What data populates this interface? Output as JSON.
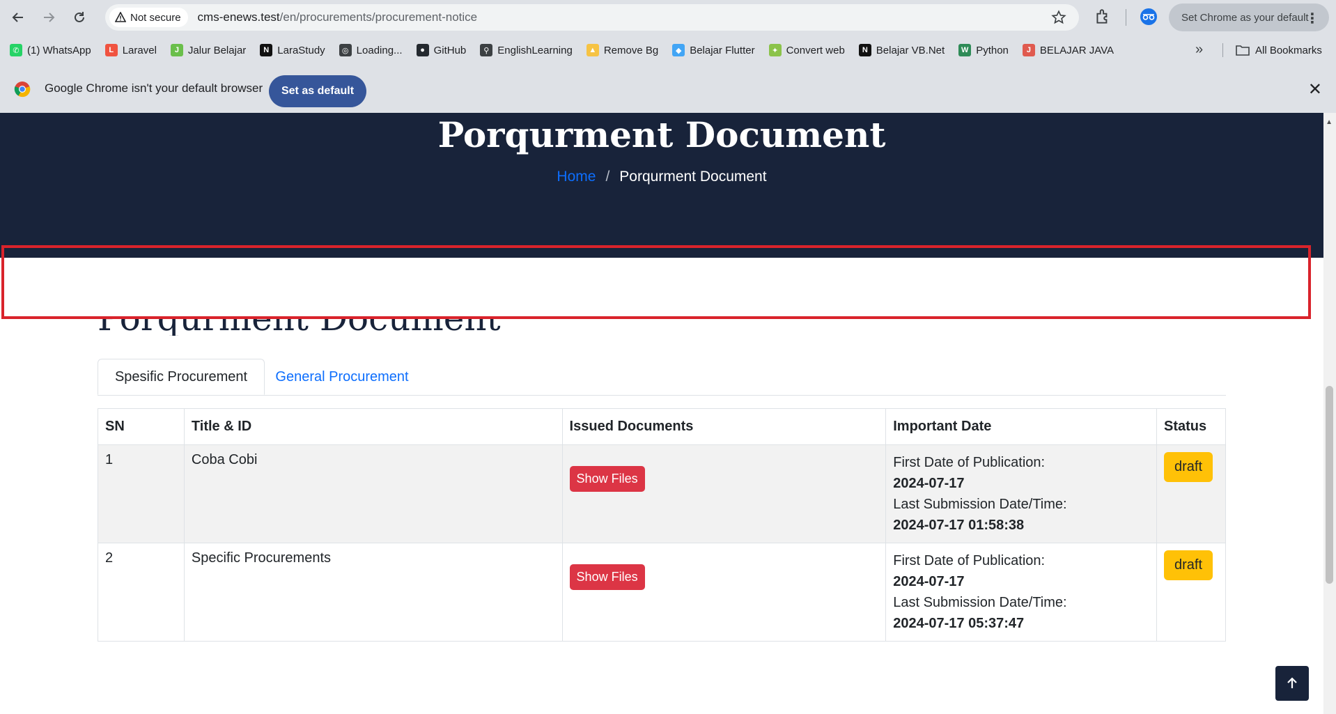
{
  "browser": {
    "security_label": "Not secure",
    "url_host": "cms-enews.test",
    "url_path": "/en/procurements/procurement-notice",
    "set_default_chip": "Set Chrome as your default"
  },
  "bookmarks": [
    {
      "label": "(1) WhatsApp",
      "icon": "whatsapp-icon",
      "color": "#25d366"
    },
    {
      "label": "Laravel",
      "icon": "laravel-icon",
      "color": "#f05340"
    },
    {
      "label": "Jalur Belajar",
      "icon": "jalur-belajar-icon",
      "color": "#6abf4b"
    },
    {
      "label": "LaraStudy",
      "icon": "notion-icon",
      "color": "#111111"
    },
    {
      "label": "Loading...",
      "icon": "globe-icon",
      "color": "#3c4043"
    },
    {
      "label": "GitHub",
      "icon": "github-icon",
      "color": "#24292f"
    },
    {
      "label": "EnglishLearning",
      "icon": "bike-icon",
      "color": "#3c4043"
    },
    {
      "label": "Remove Bg",
      "icon": "remove-bg-icon",
      "color": "#f6c344"
    },
    {
      "label": "Belajar Flutter",
      "icon": "flutter-icon",
      "color": "#42a5f5"
    },
    {
      "label": "Convert web",
      "icon": "convert-web-icon",
      "color": "#8bc34a"
    },
    {
      "label": "Belajar VB.Net",
      "icon": "notion-icon",
      "color": "#111111"
    },
    {
      "label": "Python",
      "icon": "w-icon",
      "color": "#2e8b57"
    },
    {
      "label": "BELAJAR JAVA",
      "icon": "java-icon",
      "color": "#e05a4f"
    }
  ],
  "bookmarks_all": "All Bookmarks",
  "infobar": {
    "message": "Google Chrome isn't your default browser",
    "button": "Set as default"
  },
  "page": {
    "hero_title": "Porqurment Document",
    "breadcrumb_home": "Home",
    "breadcrumb_sep": "/",
    "breadcrumb_current": "Porqurment Document",
    "section_title": "Porqurment Document",
    "tabs": [
      "Spesific Procurement",
      "General Procurement"
    ],
    "table": {
      "headers": [
        "SN",
        "Title & ID",
        "Issued Documents",
        "Important Date",
        "Status"
      ],
      "rows": [
        {
          "sn": "1",
          "title": "Coba Cobi",
          "button": "Show Files",
          "first_pub_label": "First Date of Publication:",
          "first_pub": "2024-07-17",
          "last_sub_label": "Last Submission Date/Time:",
          "last_sub": "2024-07-17 01:58:38",
          "status": "draft"
        },
        {
          "sn": "2",
          "title": "Specific Procurements",
          "button": "Show Files",
          "first_pub_label": "First Date of Publication:",
          "first_pub": "2024-07-17",
          "last_sub_label": "Last Submission Date/Time:",
          "last_sub": "2024-07-17 05:37:47",
          "status": "draft"
        }
      ]
    }
  },
  "colors": {
    "hero_bg": "#18233a",
    "danger": "#dc3545",
    "warning": "#ffc107",
    "link": "#0d6efd",
    "highlight_box": "#d9232b"
  }
}
